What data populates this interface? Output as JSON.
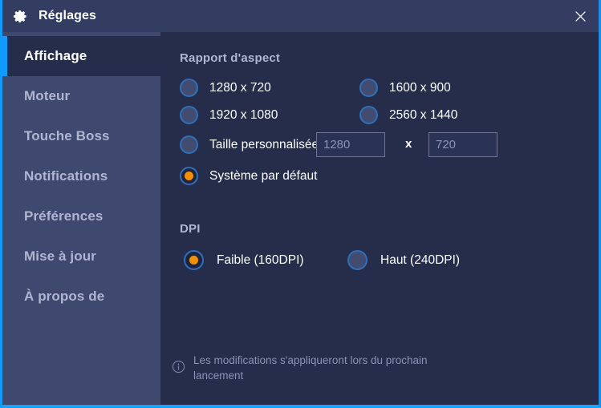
{
  "window": {
    "title": "Réglages",
    "gear_icon": "gear-icon",
    "close_icon": "close-icon",
    "accent_color": "#0f9aff",
    "titlebar_color": "#333c61",
    "sidebar_color": "#3f486e",
    "content_color": "#252d4a",
    "selected_radio_color": "#f59000"
  },
  "sidebar": {
    "items": [
      {
        "label": "Affichage",
        "active": true
      },
      {
        "label": "Moteur",
        "active": false
      },
      {
        "label": "Touche Boss",
        "active": false
      },
      {
        "label": "Notifications",
        "active": false
      },
      {
        "label": "Préférences",
        "active": false
      },
      {
        "label": "Mise à jour",
        "active": false
      },
      {
        "label": "À propos de",
        "active": false
      }
    ]
  },
  "main": {
    "aspect_section": {
      "title": "Rapport d'aspect",
      "options": [
        {
          "label": "1280 x 720",
          "selected": false
        },
        {
          "label": "1600 x 900",
          "selected": false
        },
        {
          "label": "1920 x 1080",
          "selected": false
        },
        {
          "label": "2560 x 1440",
          "selected": false
        },
        {
          "label": "Taille personnalisée",
          "selected": false
        },
        {
          "label": "Système par défaut",
          "selected": true
        }
      ],
      "custom_size": {
        "width_value": "",
        "width_placeholder": "1280",
        "separator": "x",
        "height_value": "",
        "height_placeholder": "720"
      }
    },
    "dpi_section": {
      "title": "DPI",
      "options": [
        {
          "label": "Faible (160DPI)",
          "selected": true
        },
        {
          "label": "Haut (240DPI)",
          "selected": false
        }
      ]
    },
    "footer": {
      "info_icon": "info-icon",
      "text": "Les modifications s'appliqueront lors du prochain lancement"
    }
  }
}
